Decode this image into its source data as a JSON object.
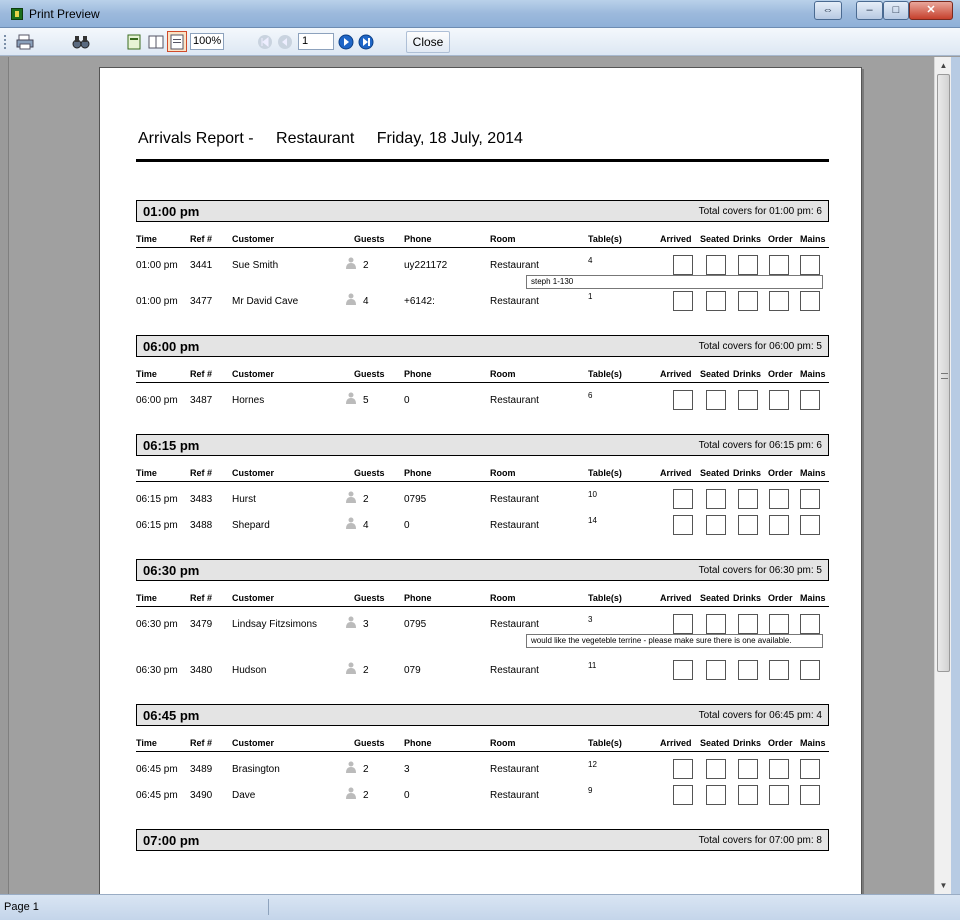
{
  "window": {
    "title": "Print Preview",
    "controls": [
      "⇔",
      "–",
      "□",
      "✕"
    ]
  },
  "toolbar": {
    "zoom": "100%",
    "page": "1",
    "close_label": "Close"
  },
  "report": {
    "title": "Arrivals Report -",
    "venue": "Restaurant",
    "date": "Friday, 18 July, 2014"
  },
  "columns": [
    "Time",
    "Ref #",
    "Customer",
    "Guests",
    "Phone",
    "Room",
    "Table(s)",
    "Arrived",
    "Seated",
    "Drinks",
    "Order",
    "Mains"
  ],
  "slots": [
    {
      "time": "01:00 pm",
      "total": "Total covers for 01:00 pm: 6",
      "bookings": [
        {
          "time": "01:00 pm",
          "ref": "3441",
          "customer": "Sue Smith",
          "guests": "2",
          "phone": "uy221172",
          "room": "Restaurant",
          "table": "4",
          "note": "steph 1-130"
        },
        {
          "time": "01:00 pm",
          "ref": "3477",
          "customer": "Mr David Cave",
          "guests": "4",
          "phone": "+6142:",
          "room": "Restaurant",
          "table": "1"
        }
      ]
    },
    {
      "time": "06:00 pm",
      "total": "Total covers for 06:00 pm: 5",
      "bookings": [
        {
          "time": "06:00 pm",
          "ref": "3487",
          "customer": "Hornes",
          "guests": "5",
          "phone": "0",
          "room": "Restaurant",
          "table": "6"
        }
      ]
    },
    {
      "time": "06:15 pm",
      "total": "Total covers for 06:15 pm: 6",
      "bookings": [
        {
          "time": "06:15 pm",
          "ref": "3483",
          "customer": "Hurst",
          "guests": "2",
          "phone": "0795",
          "room": "Restaurant",
          "table": "10"
        },
        {
          "time": "06:15 pm",
          "ref": "3488",
          "customer": "Shepard",
          "guests": "4",
          "phone": "0",
          "room": "Restaurant",
          "table": "14"
        }
      ]
    },
    {
      "time": "06:30 pm",
      "total": "Total covers for 06:30 pm: 5",
      "bookings": [
        {
          "time": "06:30 pm",
          "ref": "3479",
          "customer": "Lindsay Fitzsimons",
          "guests": "3",
          "phone": "0795",
          "room": "Restaurant",
          "table": "3",
          "note": "would like the vegeteble terrine - please make sure there is one available."
        },
        {
          "time": "06:30 pm",
          "ref": "3480",
          "customer": "Hudson",
          "guests": "2",
          "phone": "079",
          "room": "Restaurant",
          "table": "11"
        }
      ]
    },
    {
      "time": "06:45 pm",
      "total": "Total covers for 06:45 pm: 4",
      "bookings": [
        {
          "time": "06:45 pm",
          "ref": "3489",
          "customer": "Brasington",
          "guests": "2",
          "phone": "3",
          "room": "Restaurant",
          "table": "12"
        },
        {
          "time": "06:45 pm",
          "ref": "3490",
          "customer": "Dave",
          "guests": "2",
          "phone": "0",
          "room": "Restaurant",
          "table": "9"
        }
      ]
    },
    {
      "time": "07:00 pm",
      "total": "Total covers for 07:00 pm: 8",
      "bookings": []
    }
  ],
  "status": {
    "page_label": "Page 1"
  }
}
